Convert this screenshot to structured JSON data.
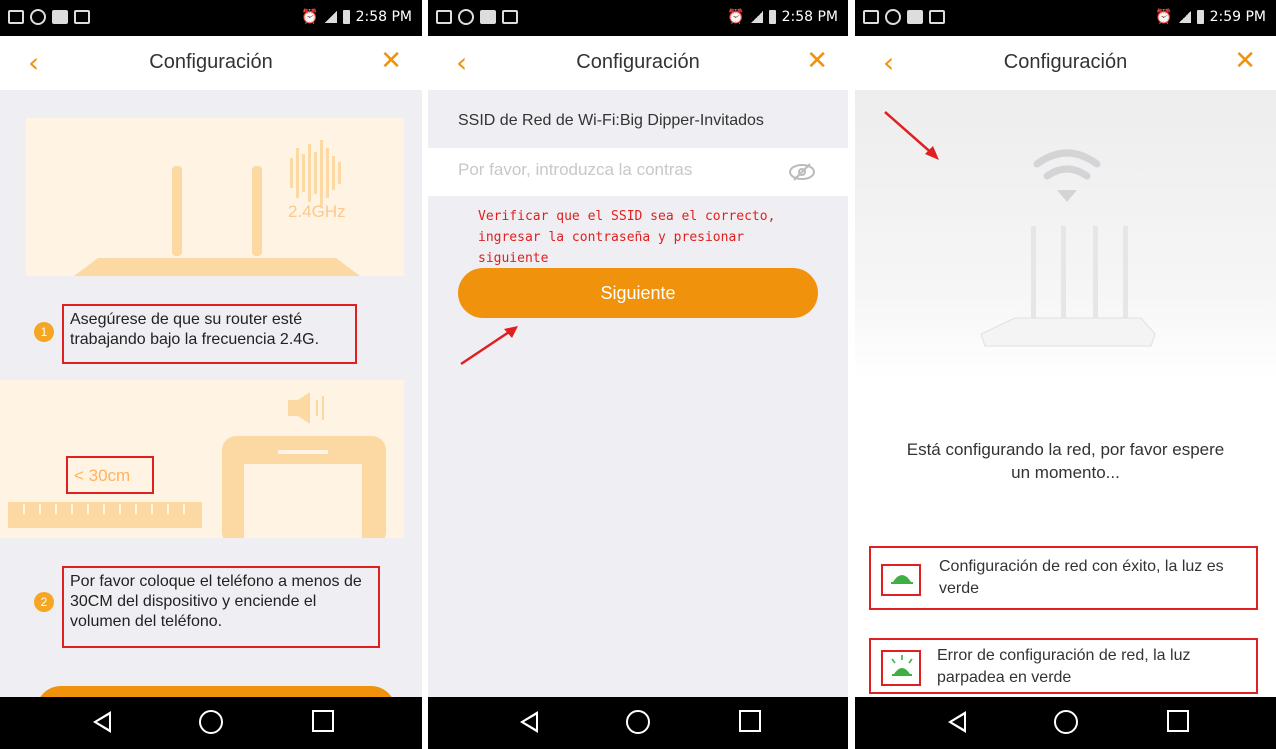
{
  "status_bars": [
    {
      "time": "2:58 PM"
    },
    {
      "time": "2:58 PM"
    },
    {
      "time": "2:59 PM"
    }
  ],
  "header": {
    "title": "Configuración",
    "back_icon": "‹",
    "close_icon": "✕"
  },
  "panel1": {
    "freq_label": "2.4GHz",
    "distance_label": "< 30cm",
    "step1_number": "1",
    "step1_text": "Asegúrese de que su router esté trabajando bajo la frecuencia 2.4G.",
    "step2_number": "2",
    "step2_text": "Por favor coloque el teléfono a menos de 30CM del dispositivo y enciende el volumen del teléfono."
  },
  "panel2": {
    "ssid_label": "SSID de Red de Wi-Fi:Big Dipper-Invitados",
    "password_placeholder": "Por favor, introduzca la contras",
    "annotation": "Verificar que el SSID sea el correcto, ingresar la contraseña y presionar siguiente",
    "next_button": "Siguiente"
  },
  "panel3": {
    "waiting_text": "Está configurando la red, por favor espere un momento...",
    "success_text": "Configuración de red con éxito, la luz es verde",
    "error_text": "Error de configuración de red, la luz parpadea en verde"
  },
  "colors": {
    "accent": "#f0920c",
    "annotation_red": "#e02020",
    "led_green": "#3cb043"
  }
}
